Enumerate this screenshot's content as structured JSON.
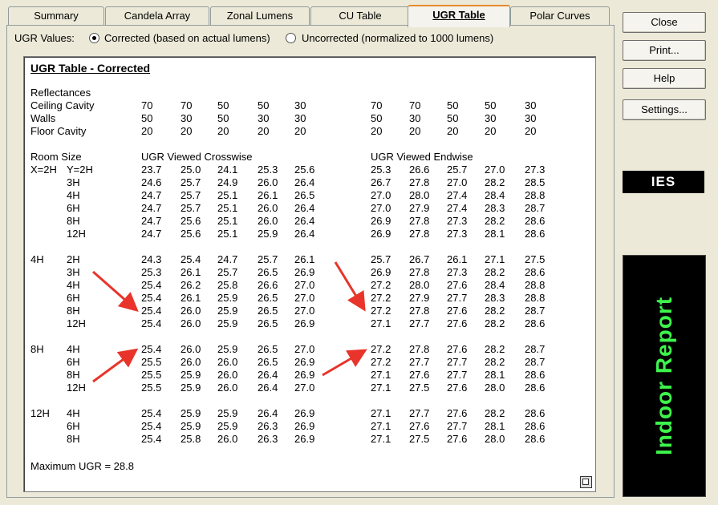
{
  "tabs": [
    "Summary",
    "Candela Array",
    "Zonal Lumens",
    "CU Table",
    "UGR Table",
    "Polar Curves"
  ],
  "ugr_values": {
    "label": "UGR Values:",
    "option_corrected": "Corrected (based on actual lumens)",
    "option_uncorrected": "Uncorrected (normalized to 1000 lumens)"
  },
  "report": {
    "title": "UGR Table - Corrected",
    "reflectances_label": "Reflectances",
    "refl_rows": [
      {
        "label": "Ceiling Cavity",
        "cross": [
          "70",
          "70",
          "50",
          "50",
          "30"
        ],
        "end": [
          "70",
          "70",
          "50",
          "50",
          "30"
        ]
      },
      {
        "label": "Walls",
        "cross": [
          "50",
          "30",
          "50",
          "30",
          "30"
        ],
        "end": [
          "50",
          "30",
          "50",
          "30",
          "30"
        ]
      },
      {
        "label": "Floor Cavity",
        "cross": [
          "20",
          "20",
          "20",
          "20",
          "20"
        ],
        "end": [
          "20",
          "20",
          "20",
          "20",
          "20"
        ]
      }
    ],
    "room_size_label": "Room Size",
    "crosswise_label": "UGR Viewed Crosswise",
    "endwise_label": "UGR Viewed Endwise",
    "groups": [
      {
        "x": "X=2H",
        "rows": [
          {
            "y": "Y=2H",
            "cross": [
              "23.7",
              "25.0",
              "24.1",
              "25.3",
              "25.6"
            ],
            "end": [
              "25.3",
              "26.6",
              "25.7",
              "27.0",
              "27.3"
            ]
          },
          {
            "y": "3H",
            "cross": [
              "24.6",
              "25.7",
              "24.9",
              "26.0",
              "26.4"
            ],
            "end": [
              "26.7",
              "27.8",
              "27.0",
              "28.2",
              "28.5"
            ]
          },
          {
            "y": "4H",
            "cross": [
              "24.7",
              "25.7",
              "25.1",
              "26.1",
              "26.5"
            ],
            "end": [
              "27.0",
              "28.0",
              "27.4",
              "28.4",
              "28.8"
            ]
          },
          {
            "y": "6H",
            "cross": [
              "24.7",
              "25.7",
              "25.1",
              "26.0",
              "26.4"
            ],
            "end": [
              "27.0",
              "27.9",
              "27.4",
              "28.3",
              "28.7"
            ]
          },
          {
            "y": "8H",
            "cross": [
              "24.7",
              "25.6",
              "25.1",
              "26.0",
              "26.4"
            ],
            "end": [
              "26.9",
              "27.8",
              "27.3",
              "28.2",
              "28.6"
            ]
          },
          {
            "y": "12H",
            "cross": [
              "24.7",
              "25.6",
              "25.1",
              "25.9",
              "26.4"
            ],
            "end": [
              "26.9",
              "27.8",
              "27.3",
              "28.1",
              "28.6"
            ]
          }
        ]
      },
      {
        "x": "4H",
        "rows": [
          {
            "y": "2H",
            "cross": [
              "24.3",
              "25.4",
              "24.7",
              "25.7",
              "26.1"
            ],
            "end": [
              "25.7",
              "26.7",
              "26.1",
              "27.1",
              "27.5"
            ]
          },
          {
            "y": "3H",
            "cross": [
              "25.3",
              "26.1",
              "25.7",
              "26.5",
              "26.9"
            ],
            "end": [
              "26.9",
              "27.8",
              "27.3",
              "28.2",
              "28.6"
            ]
          },
          {
            "y": "4H",
            "cross": [
              "25.4",
              "26.2",
              "25.8",
              "26.6",
              "27.0"
            ],
            "end": [
              "27.2",
              "28.0",
              "27.6",
              "28.4",
              "28.8"
            ]
          },
          {
            "y": "6H",
            "cross": [
              "25.4",
              "26.1",
              "25.9",
              "26.5",
              "27.0"
            ],
            "end": [
              "27.2",
              "27.9",
              "27.7",
              "28.3",
              "28.8"
            ]
          },
          {
            "y": "8H",
            "cross": [
              "25.4",
              "26.0",
              "25.9",
              "26.5",
              "27.0"
            ],
            "end": [
              "27.2",
              "27.8",
              "27.6",
              "28.2",
              "28.7"
            ]
          },
          {
            "y": "12H",
            "cross": [
              "25.4",
              "26.0",
              "25.9",
              "26.5",
              "26.9"
            ],
            "end": [
              "27.1",
              "27.7",
              "27.6",
              "28.2",
              "28.6"
            ]
          }
        ]
      },
      {
        "x": "8H",
        "rows": [
          {
            "y": "4H",
            "cross": [
              "25.4",
              "26.0",
              "25.9",
              "26.5",
              "27.0"
            ],
            "end": [
              "27.2",
              "27.8",
              "27.6",
              "28.2",
              "28.7"
            ]
          },
          {
            "y": "6H",
            "cross": [
              "25.5",
              "26.0",
              "26.0",
              "26.5",
              "26.9"
            ],
            "end": [
              "27.2",
              "27.7",
              "27.7",
              "28.2",
              "28.7"
            ]
          },
          {
            "y": "8H",
            "cross": [
              "25.5",
              "25.9",
              "26.0",
              "26.4",
              "26.9"
            ],
            "end": [
              "27.1",
              "27.6",
              "27.7",
              "28.1",
              "28.6"
            ]
          },
          {
            "y": "12H",
            "cross": [
              "25.5",
              "25.9",
              "26.0",
              "26.4",
              "27.0"
            ],
            "end": [
              "27.1",
              "27.5",
              "27.6",
              "28.0",
              "28.6"
            ]
          }
        ]
      },
      {
        "x": "12H",
        "rows": [
          {
            "y": "4H",
            "cross": [
              "25.4",
              "25.9",
              "25.9",
              "26.4",
              "26.9"
            ],
            "end": [
              "27.1",
              "27.7",
              "27.6",
              "28.2",
              "28.6"
            ]
          },
          {
            "y": "6H",
            "cross": [
              "25.4",
              "25.9",
              "25.9",
              "26.3",
              "26.9"
            ],
            "end": [
              "27.1",
              "27.6",
              "27.7",
              "28.1",
              "28.6"
            ]
          },
          {
            "y": "8H",
            "cross": [
              "25.4",
              "25.8",
              "26.0",
              "26.3",
              "26.9"
            ],
            "end": [
              "27.1",
              "27.5",
              "27.6",
              "28.0",
              "28.6"
            ]
          }
        ]
      }
    ],
    "max_ugr": "Maximum UGR = 28.8"
  },
  "buttons": [
    "Close",
    "Print...",
    "Help",
    "Settings..."
  ],
  "badges": {
    "ies": "IES",
    "indoor": "Indoor Report"
  },
  "colors": {
    "accent_tab": "#e68b2c",
    "indoor_text": "#3df44b",
    "arrows": "#e8342a"
  }
}
